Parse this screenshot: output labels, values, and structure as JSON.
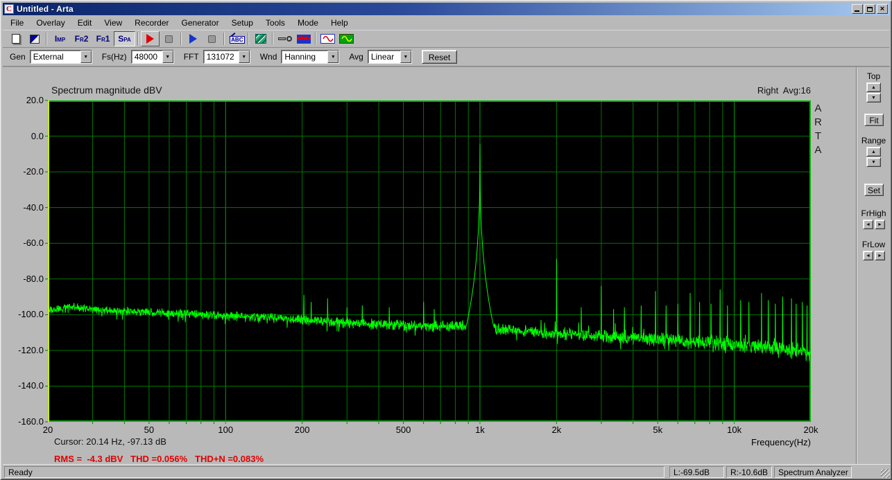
{
  "window": {
    "title": "Untitled - Arta",
    "close_glyph": "×"
  },
  "menu": {
    "items": [
      "File",
      "Overlay",
      "Edit",
      "View",
      "Recorder",
      "Generator",
      "Setup",
      "Tools",
      "Mode",
      "Help"
    ]
  },
  "toolbar": {
    "icons": [
      "new-file",
      "color-scheme",
      "imp-mode",
      "fr2-mode",
      "fr1-mode",
      "spa-mode",
      "record-start",
      "record-stop",
      "play",
      "play-stop",
      "marker-abc",
      "scale-setup",
      "input-device",
      "signal-levels",
      "generator-sine",
      "generator-output"
    ],
    "mode_buttons": [
      "Imp",
      "Fr2",
      "Fr1",
      "Spa"
    ],
    "active_mode": "Spa"
  },
  "controls": {
    "gen": {
      "label": "Gen",
      "value": "External"
    },
    "fs": {
      "label": "Fs(Hz)",
      "value": "48000"
    },
    "fft": {
      "label": "FFT",
      "value": "131072"
    },
    "wnd": {
      "label": "Wnd",
      "value": "Hanning"
    },
    "avg": {
      "label": "Avg",
      "value": "Linear"
    },
    "reset_label": "Reset"
  },
  "plot": {
    "title": "Spectrum magnitude dBV",
    "right_info": "Right  Avg:16",
    "watermark": "ARTA",
    "xlabel": "Frequency(Hz)",
    "readouts": {
      "cursor": "Cursor: 20.14 Hz, -97.13 dB",
      "rms": "RMS =  -4.3 dBV   THD =0.056%   THD+N =0.083%"
    }
  },
  "right_panel": {
    "top_label": "Top",
    "fit_label": "Fit",
    "range_label": "Range",
    "set_label": "Set",
    "frhigh_label": "FrHigh",
    "frlow_label": "FrLow"
  },
  "status_bar": {
    "ready": "Ready",
    "left_level": "L:-69.5dB",
    "right_level": "R:-10.6dB",
    "mode": "Spectrum Analyzer"
  },
  "chart_data": {
    "type": "line",
    "title": "Spectrum magnitude dBV",
    "xlabel": "Frequency(Hz)",
    "ylabel": "dBV",
    "x_scale": "log",
    "xlim": [
      20,
      20000
    ],
    "ylim": [
      -160,
      20
    ],
    "grid": true,
    "colors": {
      "curve": "#00ff00",
      "grid_minor": "#007800",
      "grid_decade": "#00a400",
      "border": "#00b400",
      "cursor": "#ffff00",
      "bg": "#000000"
    },
    "x_ticks": [
      {
        "f": 20,
        "label": "20"
      },
      {
        "f": 50,
        "label": "50"
      },
      {
        "f": 100,
        "label": "100"
      },
      {
        "f": 200,
        "label": "200"
      },
      {
        "f": 500,
        "label": "500"
      },
      {
        "f": 1000,
        "label": "1k"
      },
      {
        "f": 2000,
        "label": "2k"
      },
      {
        "f": 5000,
        "label": "5k"
      },
      {
        "f": 10000,
        "label": "10k"
      },
      {
        "f": 20000,
        "label": "20k"
      }
    ],
    "y_ticks": [
      {
        "v": 20,
        "label": "20.0"
      },
      {
        "v": 0,
        "label": "0.0"
      },
      {
        "v": -20,
        "label": "-20.0"
      },
      {
        "v": -40,
        "label": "-40.0"
      },
      {
        "v": -60,
        "label": "-60.0"
      },
      {
        "v": -80,
        "label": "-80.0"
      },
      {
        "v": -100,
        "label": "-100.0"
      },
      {
        "v": -120,
        "label": "-120.0"
      },
      {
        "v": -140,
        "label": "-140.0"
      },
      {
        "v": -160,
        "label": "-160.0"
      }
    ],
    "channel": "Right",
    "avg_count": 16,
    "fundamental": {
      "freq": 1000,
      "level_dbv": -4.5
    },
    "stats": {
      "rms_dbv": -4.3,
      "thd_pct": 0.056,
      "thdn_pct": 0.083
    },
    "cursor": {
      "freq_hz": 20.14,
      "level_db": -97.13
    },
    "noise_floor": [
      [
        20,
        -97.5
      ],
      [
        25,
        -95.5
      ],
      [
        30,
        -97
      ],
      [
        40,
        -98
      ],
      [
        50,
        -98.5
      ],
      [
        60,
        -99
      ],
      [
        80,
        -100
      ],
      [
        100,
        -100.5
      ],
      [
        140,
        -101.5
      ],
      [
        200,
        -103
      ],
      [
        300,
        -104.5
      ],
      [
        400,
        -105.5
      ],
      [
        550,
        -106
      ],
      [
        700,
        -106.5
      ],
      [
        900,
        -106
      ],
      [
        1200,
        -108
      ],
      [
        1600,
        -109.5
      ],
      [
        2000,
        -110.5
      ],
      [
        3000,
        -112
      ],
      [
        4000,
        -113
      ],
      [
        6000,
        -114.5
      ],
      [
        9000,
        -116
      ],
      [
        12000,
        -117.5
      ],
      [
        16000,
        -119
      ],
      [
        20000,
        -121
      ]
    ],
    "spikes": [
      [
        203,
        -89
      ],
      [
        217,
        -93
      ],
      [
        252,
        -91
      ],
      [
        300,
        -96
      ],
      [
        345,
        -95
      ],
      [
        440,
        -96
      ],
      [
        600,
        -93
      ],
      [
        660,
        -97
      ],
      [
        2000,
        -69
      ],
      [
        2500,
        -96
      ],
      [
        3000,
        -84
      ],
      [
        3350,
        -97
      ],
      [
        3700,
        -96
      ],
      [
        4300,
        -95
      ],
      [
        4900,
        -87
      ],
      [
        5400,
        -95
      ],
      [
        6000,
        -94
      ],
      [
        6700,
        -88
      ],
      [
        7300,
        -93
      ],
      [
        8100,
        -94
      ],
      [
        8800,
        -86
      ],
      [
        9400,
        -95
      ],
      [
        10600,
        -92
      ],
      [
        11400,
        -93
      ],
      [
        12800,
        -88
      ],
      [
        13600,
        -92
      ],
      [
        14500,
        -94
      ],
      [
        15500,
        -90
      ],
      [
        16800,
        -91
      ],
      [
        17500,
        -94
      ],
      [
        18500,
        -93
      ],
      [
        19300,
        -95
      ]
    ]
  }
}
